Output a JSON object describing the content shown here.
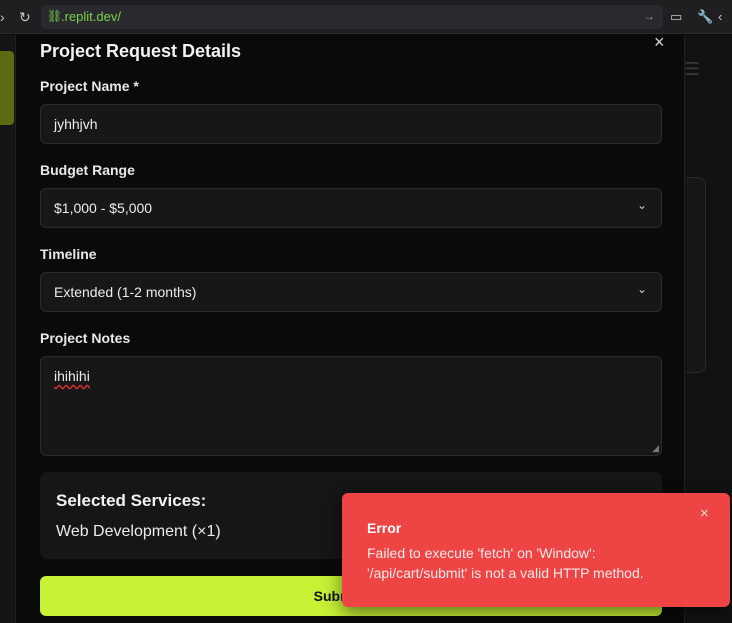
{
  "browser": {
    "url": ".replit.dev/",
    "icons": [
      "chevron-right-icon",
      "reload-icon",
      "link-icon",
      "arrow-right-icon",
      "monitor-icon",
      "wrench-icon",
      "code-icon"
    ]
  },
  "modal": {
    "title": "Project Request Details",
    "close_glyph": "×",
    "project_name": {
      "label": "Project Name *",
      "value": "jyhhjvh"
    },
    "budget": {
      "label": "Budget Range",
      "selected": "$1,000 - $5,000"
    },
    "timeline": {
      "label": "Timeline",
      "selected": "Extended (1-2 months)"
    },
    "notes": {
      "label": "Project Notes",
      "value": "ihihihi"
    },
    "services": {
      "title": "Selected Services:",
      "item": "Web Development (×1)"
    },
    "submit_label": "Submit Pro"
  },
  "toast": {
    "title": "Error",
    "message": "Failed to execute 'fetch' on 'Window': '/api/cart/submit' is not a valid HTTP method.",
    "close_glyph": "×",
    "color": "#ef4444"
  },
  "colors": {
    "accent": "#c6f135",
    "error": "#ef4444",
    "url": "#7bd14c"
  }
}
